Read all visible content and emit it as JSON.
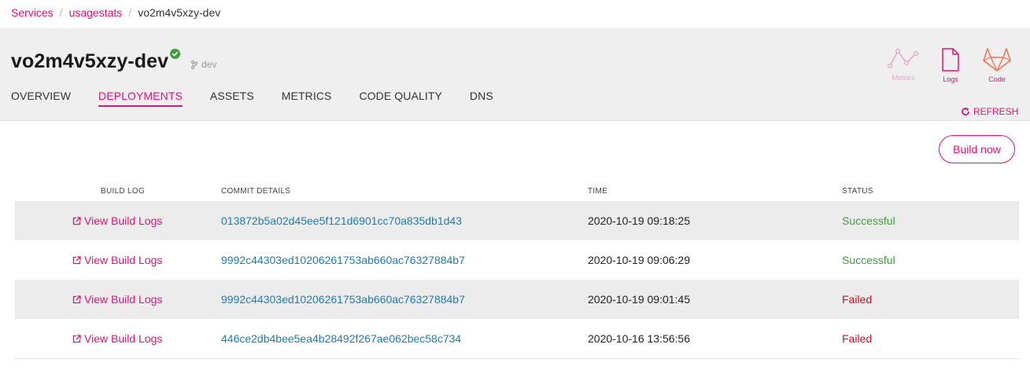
{
  "breadcrumb": {
    "items": [
      "Services",
      "usagestats"
    ],
    "current": "vo2m4v5xzy-dev"
  },
  "header": {
    "title": "vo2m4v5xzy-dev",
    "branch": "dev",
    "tabs": [
      "OVERVIEW",
      "DEPLOYMENTS",
      "ASSETS",
      "METRICS",
      "CODE QUALITY",
      "DNS"
    ],
    "active_tab": "DEPLOYMENTS",
    "tools": {
      "metrics": "Metrics",
      "logs": "Logs",
      "code": "Code"
    },
    "refresh_label": "REFRESH"
  },
  "actions": {
    "build_now": "Build now"
  },
  "table": {
    "columns": {
      "build_log": "BUILD LOG",
      "commit": "COMMIT DETAILS",
      "time": "TIME",
      "status": "STATUS"
    },
    "rows": [
      {
        "log": "View Build Logs",
        "commit": "013872b5a02d45ee5f121d6901cc70a835db1d43",
        "time": "2020-10-19 09:18:25",
        "status": "Successful"
      },
      {
        "log": "View Build Logs",
        "commit": "9992c44303ed10206261753ab660ac76327884b7",
        "time": "2020-10-19 09:06:29",
        "status": "Successful"
      },
      {
        "log": "View Build Logs",
        "commit": "9992c44303ed10206261753ab660ac76327884b7",
        "time": "2020-10-19 09:01:45",
        "status": "Failed"
      },
      {
        "log": "View Build Logs",
        "commit": "446ce2db4bee5ea4b28492f267ae062bec58c734",
        "time": "2020-10-16 13:56:56",
        "status": "Failed"
      }
    ]
  },
  "colors": {
    "accent": "#e0137a",
    "link": "#1a7fb0",
    "success": "#3da03d",
    "failed": "#d0102a",
    "header_bg": "#efefef",
    "row_shade": "#ececec"
  }
}
